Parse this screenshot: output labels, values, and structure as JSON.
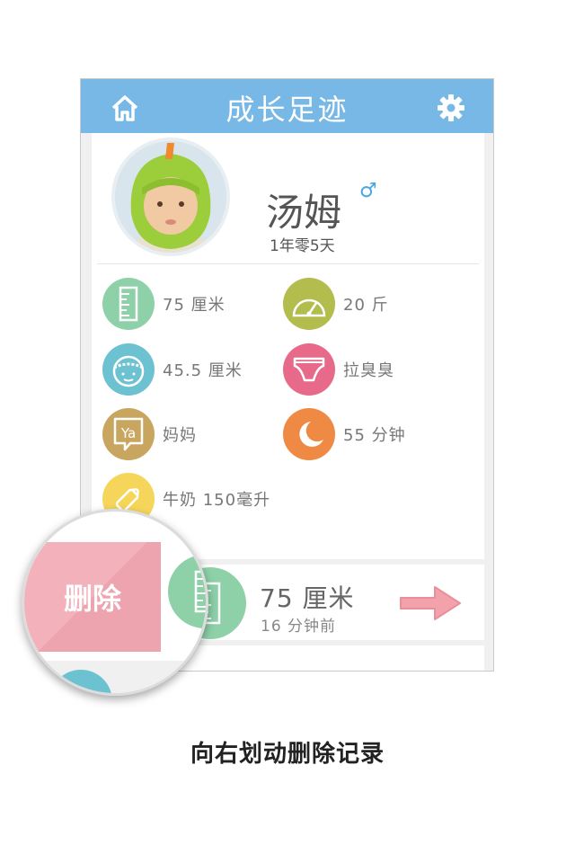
{
  "header": {
    "title": "成长足迹",
    "home_icon": "home-icon",
    "settings_icon": "gear-icon",
    "color": "#77b8e6"
  },
  "profile": {
    "name": "汤姆",
    "gender_symbol": "♂",
    "age": "1年零5天"
  },
  "stats": [
    {
      "icon": "height-ruler-icon",
      "label": "75 厘米",
      "color": "#8ed1a9"
    },
    {
      "icon": "weight-scale-icon",
      "label": "20 斤",
      "color": "#b3bd4e"
    },
    {
      "icon": "head-circumference-icon",
      "label": "45.5 厘米",
      "color": "#6cc2d1"
    },
    {
      "icon": "diaper-icon",
      "label": "拉臭臭",
      "color": "#e76a8a"
    },
    {
      "icon": "speech-bubble-icon",
      "label": "妈妈",
      "color": "#c9a660"
    },
    {
      "icon": "sleep-moon-icon",
      "label": "55 分钟",
      "color": "#ee8a43"
    },
    {
      "icon": "baby-bottle-icon",
      "label": "牛奶 150毫升",
      "color": "#f6d65a"
    }
  ],
  "record": {
    "value": "75 厘米",
    "time": "16 分钟前",
    "delete_label": "删除"
  },
  "caption": "向右划动删除记录"
}
